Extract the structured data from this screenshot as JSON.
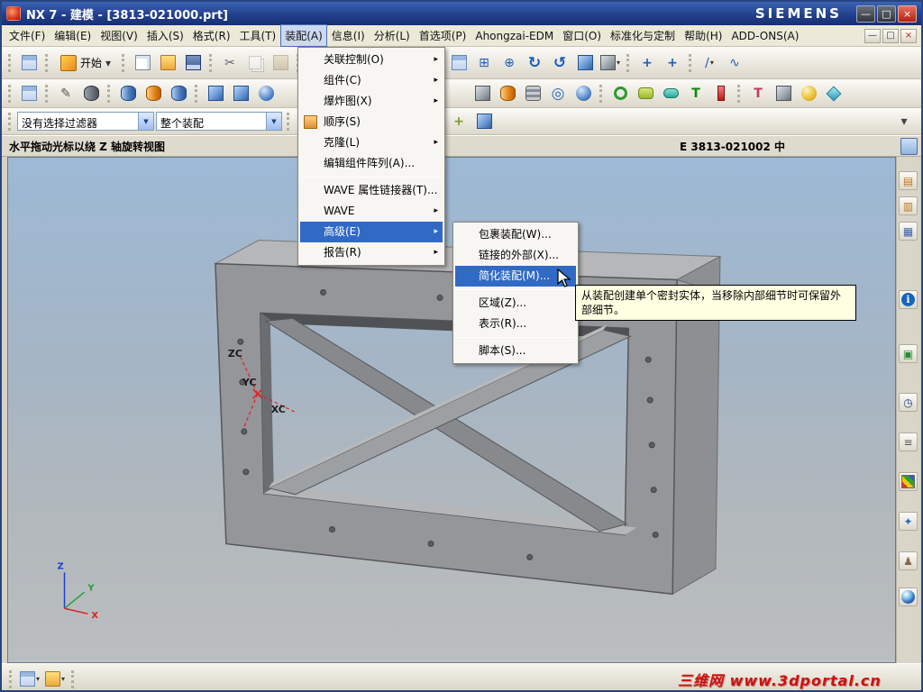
{
  "window": {
    "title": "NX 7 - 建模 - [3813-021000.prt]",
    "brand": "SIEMENS"
  },
  "menubar": {
    "items": [
      "文件(F)",
      "编辑(E)",
      "视图(V)",
      "插入(S)",
      "格式(R)",
      "工具(T)",
      "装配(A)",
      "信息(I)",
      "分析(L)",
      "首选项(P)",
      "Ahongzai-EDM",
      "窗口(O)",
      "标准化与定制",
      "帮助(H)",
      "ADD-ONS(A)"
    ]
  },
  "toolbar": {
    "start_label": "开始"
  },
  "filters": {
    "selection_filter": "没有选择过滤器",
    "scope": "整个装配"
  },
  "assembly_menu": {
    "items": [
      "关联控制(O)",
      "组件(C)",
      "爆炸图(X)",
      "顺序(S)",
      "克隆(L)",
      "编辑组件阵列(A)...",
      "WAVE 属性链接器(T)...",
      "WAVE",
      "高级(E)",
      "报告(R)"
    ]
  },
  "advanced_submenu": {
    "items": [
      "包裹装配(W)...",
      "链接的外部(X)...",
      "简化装配(M)...",
      "区域(Z)...",
      "表示(R)...",
      "脚本(S)..."
    ]
  },
  "tooltip": {
    "text": "从装配创建单个密封实体，当移除内部细节时可保留外部细节。"
  },
  "statusbar": {
    "prompt": "水平拖动光标以绕 Z 轴旋转视图",
    "right": "E 3813-021002 中"
  },
  "viewport": {
    "wcs": {
      "z": "ZC",
      "y": "YC",
      "x": "XC"
    },
    "triad": {
      "z": "Z",
      "y": "Y",
      "x": "X"
    }
  },
  "watermark": {
    "text": "三维网 www.3dportal.cn"
  },
  "icons": {
    "minimize": {
      "glyph": "—",
      "color": "#ffffff"
    },
    "restore": {
      "glyph": "□",
      "color": "#ffffff"
    },
    "close": {
      "glyph": "×",
      "color": "#ffffff"
    },
    "mdi-minimize": {
      "glyph": "—",
      "color": "#333333"
    },
    "mdi-restore": {
      "glyph": "□",
      "color": "#333333"
    },
    "mdi-close": {
      "glyph": "×",
      "color": "#bb2222"
    },
    "dropdown": {
      "glyph": "▾",
      "color": "#333333"
    },
    "combo-arrow": {
      "glyph": "▼",
      "color": "#1b3f7e"
    },
    "scissors": {
      "glyph": "✂",
      "color": "#556070"
    },
    "delete": {
      "glyph": "×",
      "color": "#667080"
    },
    "refresh": {
      "glyph": "↻",
      "color": "#1b5cb8"
    },
    "orbit": {
      "glyph": "↺",
      "color": "#1b5cb8"
    },
    "zoom": {
      "glyph": "⊕",
      "color": "#1b5cb8"
    },
    "zoom-box": {
      "glyph": "⊞",
      "color": "#1b5cb8"
    },
    "fit": {
      "glyph": "▣",
      "color": "#1b5cb8"
    },
    "pencil": {
      "glyph": "✎",
      "color": "#555555"
    },
    "line": {
      "glyph": "∕",
      "color": "#1b5cb8"
    },
    "spline": {
      "glyph": "∿",
      "color": "#1b5cb8"
    },
    "axes": {
      "glyph": "+",
      "color": "#1b5cb8"
    },
    "snap": {
      "glyph": "+",
      "color": "#7a9a30"
    },
    "torus": {
      "glyph": "◎",
      "color": "#2a6ac0"
    },
    "tee-green": {
      "glyph": "T",
      "color": "#0a8a0a"
    },
    "tee-red": {
      "glyph": "T",
      "color": "#c03a5a"
    },
    "submenu-arrow": {
      "glyph": "▸"
    },
    "clock": {
      "glyph": "◷",
      "color": "#1b3f7e"
    },
    "list": {
      "glyph": "≡",
      "color": "#555555"
    },
    "info": {
      "glyph": "i"
    },
    "star": {
      "glyph": "✦",
      "color": "#2a6ac0"
    },
    "person": {
      "glyph": "♟",
      "color": "#886650"
    },
    "nav1": {
      "glyph": "▤",
      "color": "#c07818"
    },
    "nav2": {
      "glyph": "▥",
      "color": "#c07818"
    },
    "nav3": {
      "glyph": "▦",
      "color": "#3a66b0"
    },
    "opnav": {
      "glyph": "▣",
      "color": "#2a8a3a"
    },
    "overflow": {
      "glyph": "▾",
      "color": "#444444"
    }
  }
}
